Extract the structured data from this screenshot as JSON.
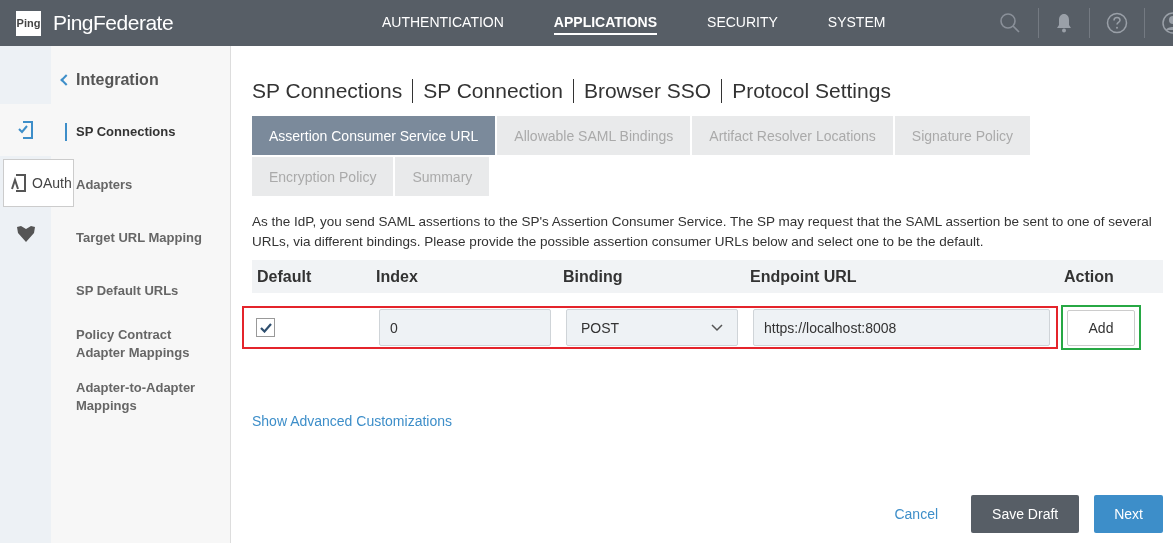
{
  "header": {
    "logo_badge": "Ping",
    "brand": "PingFederate",
    "nav": [
      {
        "label": "AUTHENTICATION",
        "selected": false
      },
      {
        "label": "APPLICATIONS",
        "selected": true
      },
      {
        "label": "SECURITY",
        "selected": false
      },
      {
        "label": "SYSTEM",
        "selected": false
      }
    ]
  },
  "sidebar": {
    "back_label": "Integration",
    "rail": [
      {
        "selected": true
      },
      {
        "selected": false
      }
    ],
    "tooltip": "OAuth",
    "items": [
      {
        "label": "SP Connections",
        "selected": true
      },
      {
        "label": "Adapters",
        "selected": false
      },
      {
        "label": "Target URL Mapping",
        "selected": false
      },
      {
        "label": "SP Default URLs",
        "selected": false
      },
      {
        "label": "Policy Contract Adapter Mappings",
        "selected": false
      },
      {
        "label": "Adapter-to-Adapter Mappings",
        "selected": false
      }
    ]
  },
  "breadcrumb": [
    "SP Connections",
    "SP Connection",
    "Browser SSO",
    "Protocol Settings"
  ],
  "tabs": [
    {
      "label": "Assertion Consumer Service URL",
      "selected": true
    },
    {
      "label": "Allowable SAML Bindings",
      "selected": false
    },
    {
      "label": "Artifact Resolver Locations",
      "selected": false
    },
    {
      "label": "Signature Policy",
      "selected": false
    },
    {
      "label": "Encryption Policy",
      "selected": false
    },
    {
      "label": "Summary",
      "selected": false
    }
  ],
  "description": "As the IdP, you send SAML assertions to the SP's Assertion Consumer Service. The SP may request that the SAML assertion be sent to one of several URLs, via different bindings. Please provide the possible assertion consumer URLs below and select one to be the default.",
  "table": {
    "columns": [
      "Default",
      "Index",
      "Binding",
      "Endpoint URL",
      "Action"
    ],
    "row": {
      "default_checked": true,
      "index": "0",
      "binding": "POST",
      "endpoint_url": "https://localhost:8008",
      "action": "Add"
    }
  },
  "advanced_link": "Show Advanced Customizations",
  "buttons": [
    {
      "label": "Cancel",
      "kind": "link"
    },
    {
      "label": "Save Draft",
      "kind": "dark"
    },
    {
      "label": "Next",
      "kind": "primary"
    }
  ]
}
